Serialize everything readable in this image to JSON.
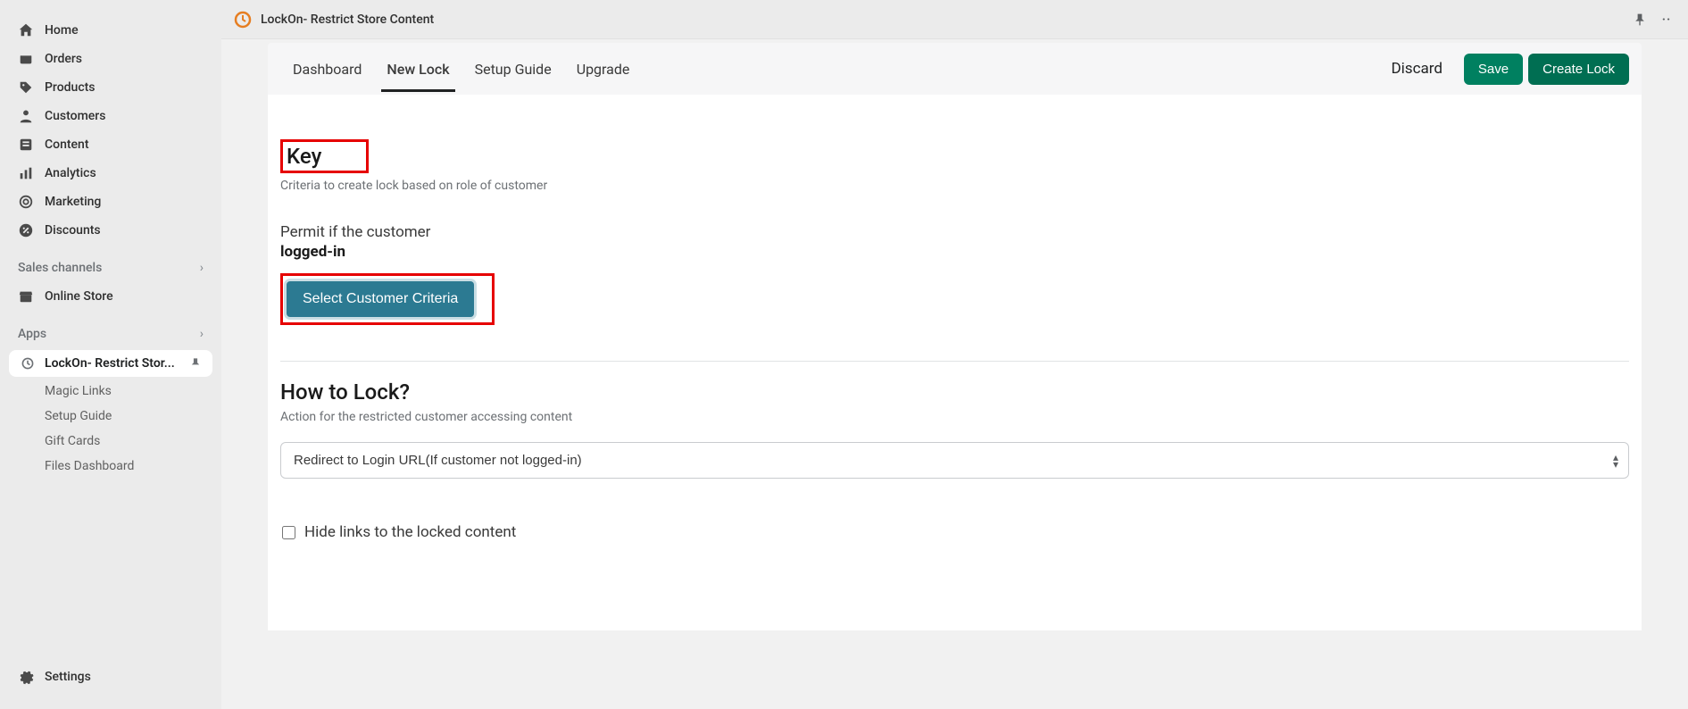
{
  "topbar": {
    "app_title": "LockOn- Restrict Store Content"
  },
  "sidebar": {
    "nav": [
      {
        "label": "Home",
        "icon": "home"
      },
      {
        "label": "Orders",
        "icon": "orders"
      },
      {
        "label": "Products",
        "icon": "products"
      },
      {
        "label": "Customers",
        "icon": "customers"
      },
      {
        "label": "Content",
        "icon": "content"
      },
      {
        "label": "Analytics",
        "icon": "analytics"
      },
      {
        "label": "Marketing",
        "icon": "marketing"
      },
      {
        "label": "Discounts",
        "icon": "discounts"
      }
    ],
    "sales_channels_label": "Sales channels",
    "online_store_label": "Online Store",
    "apps_label": "Apps",
    "active_app_label": "LockOn- Restrict Stor...",
    "app_subitems": [
      "Magic Links",
      "Setup Guide",
      "Gift Cards",
      "Files Dashboard"
    ],
    "settings_label": "Settings"
  },
  "tabs": {
    "dashboard": "Dashboard",
    "new_lock": "New Lock",
    "setup_guide": "Setup Guide",
    "upgrade": "Upgrade"
  },
  "actions": {
    "discard": "Discard",
    "save": "Save",
    "create_lock": "Create Lock"
  },
  "key_section": {
    "title": "Key",
    "desc": "Criteria to create lock based on role of customer",
    "permit_label": "Permit if the customer",
    "permit_value": "logged-in",
    "criteria_btn": "Select Customer Criteria"
  },
  "how_section": {
    "title": "How to Lock?",
    "desc": "Action for the restricted customer accessing content",
    "select_value": "Redirect to Login URL(If customer not logged-in)",
    "hide_links_label": "Hide links to the locked content"
  }
}
